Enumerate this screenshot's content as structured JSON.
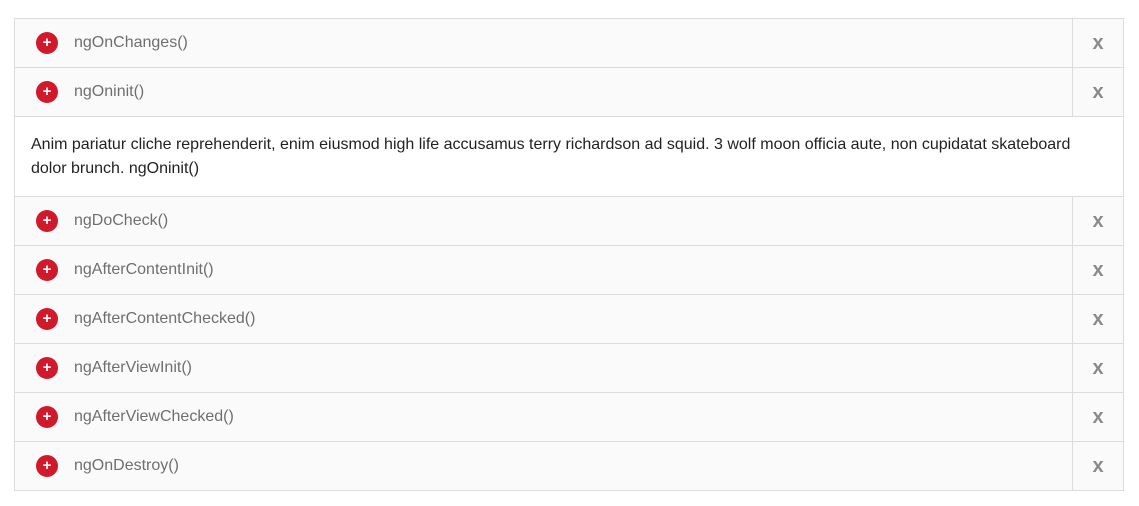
{
  "accordion": {
    "items": [
      {
        "label": "ngOnChanges()",
        "close": "x"
      },
      {
        "label": "ngOninit()",
        "close": "x"
      },
      {
        "label": "ngDoCheck()",
        "close": "x"
      },
      {
        "label": "ngAfterContentInit()",
        "close": "x"
      },
      {
        "label": "ngAfterContentChecked()",
        "close": "x"
      },
      {
        "label": "ngAfterViewInit()",
        "close": "x"
      },
      {
        "label": "ngAfterViewChecked()",
        "close": "x"
      },
      {
        "label": "ngOnDestroy()",
        "close": "x"
      }
    ],
    "expanded_body": "Anim pariatur cliche reprehenderit, enim eiusmod high life accusamus terry richardson ad squid. 3 wolf moon officia aute, non cupidatat skateboard dolor brunch. ngOninit()",
    "icon_symbol": "+",
    "accent_color": "#d0192a"
  }
}
